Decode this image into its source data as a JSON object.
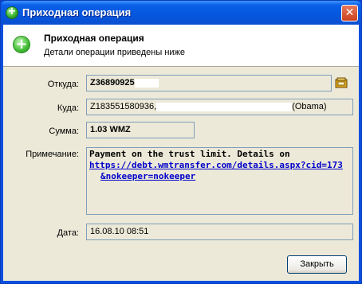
{
  "window": {
    "title": "Приходная операция",
    "close_glyph": "✕",
    "title_icon": "plus-circle-icon"
  },
  "header": {
    "icon": "plus-circle-icon",
    "title": "Приходная операция",
    "subtitle": "Детали операции приведены ниже"
  },
  "form": {
    "from": {
      "label": "Откуда:",
      "value": "Z36890925"
    },
    "to": {
      "label": "Куда:",
      "value": "Z183551580936,",
      "suffix": "(Obama)"
    },
    "amount": {
      "label": "Сумма:",
      "value": "1.03 WMZ"
    },
    "note": {
      "label": "Примечание:",
      "text": "Payment on the trust limit. Details on",
      "link_part1": "https://debt.wmtransfer.com/details.aspx?cid=",
      "link_part2": "173",
      "link_part3": "&nokeeper=nokeeper"
    },
    "date": {
      "label": "Дата:",
      "value": "16.08.10 08:51"
    }
  },
  "buttons": {
    "close_label": "Закрыть"
  },
  "colors": {
    "titlebar": "#0558e0",
    "client": "#ece9d8",
    "field_border": "#7f9db9",
    "link": "#0000cc"
  }
}
